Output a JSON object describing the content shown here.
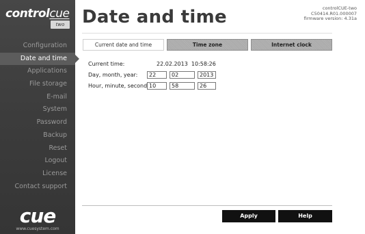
{
  "logo": {
    "part1": "control",
    "part2": "cue",
    "sub": "two"
  },
  "brand": {
    "name": "cue",
    "url": "www.cuesystem.com"
  },
  "nav": {
    "items": [
      {
        "label": "Configuration"
      },
      {
        "label": "Date and time"
      },
      {
        "label": "Applications"
      },
      {
        "label": "File storage"
      },
      {
        "label": "E-mail"
      },
      {
        "label": "System"
      },
      {
        "label": "Password"
      },
      {
        "label": "Backup"
      },
      {
        "label": "Reset"
      },
      {
        "label": "Logout"
      },
      {
        "label": "License"
      },
      {
        "label": "Contact support"
      }
    ]
  },
  "header": {
    "title": "Date and time",
    "device_name": "controlCUE-two",
    "serial": "C50414.R01.000007",
    "firmware": "firmware version: 4.31a"
  },
  "tabs": [
    {
      "label": "Current date and time"
    },
    {
      "label": "Time zone"
    },
    {
      "label": "Internet clock"
    }
  ],
  "form": {
    "current_time_label": "Current time:",
    "current_date": "22.02.2013",
    "current_clock": "10:58:26",
    "date_label": "Day, month, year:",
    "day": "22",
    "month": "02",
    "year": "2013",
    "time_label": "Hour, minute, second:",
    "hour": "10",
    "minute": "58",
    "second": "26"
  },
  "buttons": {
    "apply": "Apply",
    "help": "Help"
  }
}
